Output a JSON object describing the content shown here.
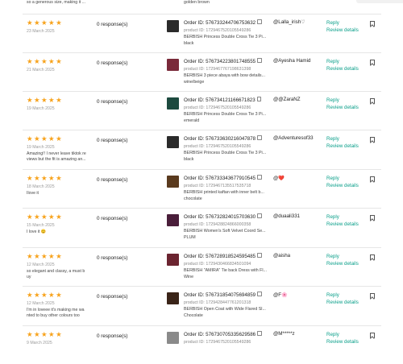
{
  "top_fragment": {
    "comment": "so a generous size, making it ...",
    "variant": "golden brown"
  },
  "labels": {
    "reply": "Reply",
    "review_details": "Review details",
    "order_prefix": "Order ID: ",
    "product_prefix": "product ID: "
  },
  "colors": {
    "star": "#f7a21b",
    "link": "#0a9f8a"
  },
  "reviews": [
    {
      "stars": "★★★★★",
      "date": "23 March 2025",
      "comment": "",
      "responses": "0 response(s)",
      "order_id": "576733244706753632",
      "product_id": "1729467520105549286",
      "product_name": "BERBISH Princess Double Cross Tie 3 Pi...",
      "variant": "black",
      "user": "@Lalla_irish♡",
      "thumb": "#2b2b2b"
    },
    {
      "stars": "★★★★★",
      "date": "21 March 2025",
      "comment": "",
      "responses": "0 response(s)",
      "order_id": "576734223801748555",
      "product_id": "1729467767198631398",
      "product_name": "BERBISH 3 piece abaya with bow details...",
      "variant": "wine/beige",
      "user": "@Ayesha Hamid",
      "thumb": "#7a2a3a"
    },
    {
      "stars": "★★★★★",
      "date": "19 March 2025",
      "comment": "",
      "responses": "0 response(s)",
      "order_id": "576734121166671823",
      "product_id": "1729467520105549286",
      "product_name": "BERBISH Princess Double Cross Tie 3 Pi...",
      "variant": "emerald",
      "user": "@@ZaraNZ",
      "thumb": "#1d4a3f"
    },
    {
      "stars": "★★★★★",
      "date": "19 March 2025",
      "comment": "Amazing!! I never leave tiktok re views but the fit is amazing an...",
      "responses": "0 response(s)",
      "order_id": "576733630216047878",
      "product_id": "1729467520105549286",
      "product_name": "BERBISH Princess Double Cross Tie 3 Pi...",
      "variant": "black",
      "user": "@Adventuresof33",
      "thumb": "#2b2b2b"
    },
    {
      "stars": "★★★★★",
      "date": "18 March 2025",
      "comment": "Ilove it",
      "responses": "0 response(s)",
      "order_id": "576733343677910545",
      "product_id": "1729467135517535718",
      "product_name": "BERBISH printed kaftan with inner belt b...",
      "variant": "chocolate",
      "user": "@❤️",
      "thumb": "#5a3a1e"
    },
    {
      "stars": "★★★★★",
      "date": "15 March 2025",
      "comment": "I love it 😊",
      "responses": "0 response(s)",
      "order_id": "576732824015703630",
      "product_id": "1729428824866000358",
      "product_name": "BERBISH Women's Soft Velvet Coord Se...",
      "variant": "PLUM",
      "user": "@duaali331",
      "thumb": "#4a1e3a"
    },
    {
      "stars": "★★★★★",
      "date": "12 March 2025",
      "comment": "so elegant and classy, a must b uy",
      "responses": "0 response(s)",
      "order_id": "576728918524595485",
      "product_id": "1729430466834501094",
      "product_name": "BERBISH \"AMIRA\" Tie back Dress with Fl...",
      "variant": "Wine",
      "user": "@aisha",
      "thumb": "#6b2430"
    },
    {
      "stars": "★★★★★",
      "date": "12 March 2025",
      "comment": "I'm in loveee it's making me wa nted to buy other colours too",
      "responses": "0 response(s)",
      "order_id": "576731854075694859",
      "product_id": "1729428447761201318",
      "product_name": "BERBISH Open Coat with Wide Flared Sl...",
      "variant": "Chocolate",
      "user": "@F🌸",
      "thumb": "#3a2418"
    },
    {
      "stars": "★★★★★",
      "date": "9 March 2025",
      "comment": "",
      "responses": "0 response(s)",
      "order_id": "576730705335629586",
      "product_id": "1729467520105549286",
      "product_name": "",
      "variant": "",
      "user": "@M*****z",
      "thumb": "#8a8a8a"
    }
  ]
}
